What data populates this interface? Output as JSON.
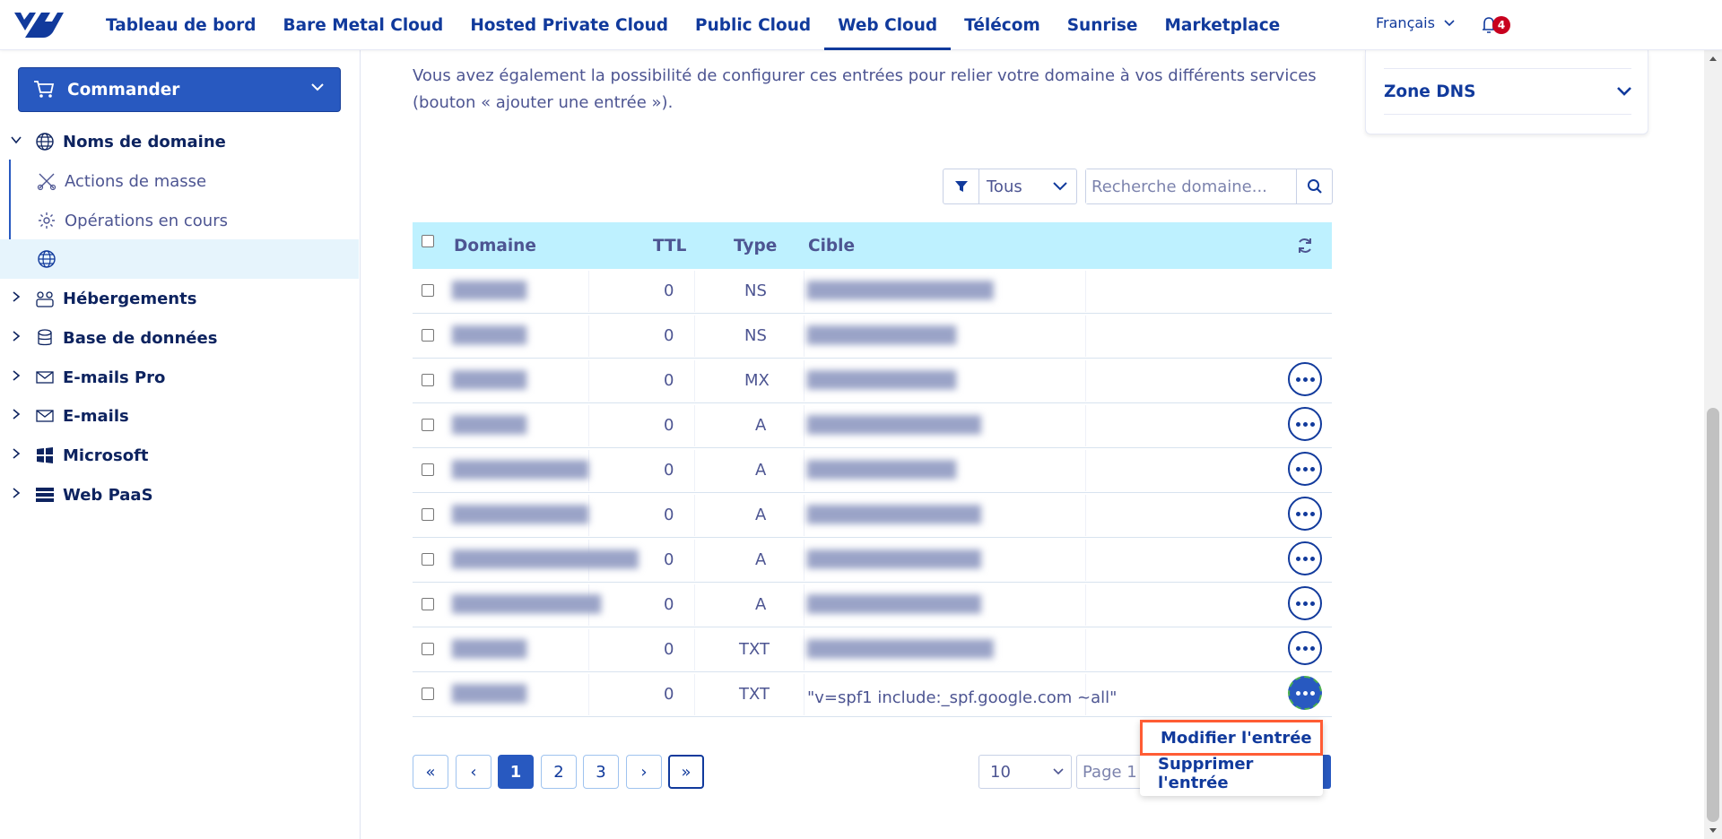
{
  "nav": {
    "items": [
      "Tableau de bord",
      "Bare Metal Cloud",
      "Hosted Private Cloud",
      "Public Cloud",
      "Web Cloud",
      "Télécom",
      "Sunrise",
      "Marketplace"
    ],
    "active": "Web Cloud",
    "language": "Français",
    "notifications_count": "4"
  },
  "sidebar": {
    "order_button": "Commander",
    "items": [
      {
        "label": "Noms de domaine",
        "icon": "globe-icon",
        "expanded": true
      },
      {
        "label": "Actions de masse",
        "icon": "scissors-icon"
      },
      {
        "label": "Opérations en cours",
        "icon": "gear-icon"
      },
      {
        "label": "",
        "icon": "globe-icon"
      },
      {
        "label": "Hébergements",
        "icon": "hosting-icon"
      },
      {
        "label": "Base de données",
        "icon": "database-icon"
      },
      {
        "label": "E-mails Pro",
        "icon": "mail-icon"
      },
      {
        "label": "E-mails",
        "icon": "mail-icon"
      },
      {
        "label": "Microsoft",
        "icon": "windows-icon"
      },
      {
        "label": "Web PaaS",
        "icon": "menu-icon"
      }
    ]
  },
  "intro_text": "Vous avez également la possibilité de configurer ces entrées pour relier votre domaine à vos différents services (bouton « ajouter une entrée »).",
  "filter": {
    "selected": "Tous"
  },
  "search": {
    "placeholder": "Recherche domaine...",
    "value": ""
  },
  "table": {
    "headers": {
      "domain": "Domaine",
      "ttl": "TTL",
      "type": "Type",
      "target": "Cible"
    },
    "rows": [
      {
        "domain": "██████",
        "ttl": "0",
        "type": "NS",
        "target": "███████████████",
        "actions": false
      },
      {
        "domain": "██████",
        "ttl": "0",
        "type": "NS",
        "target": "████████████",
        "actions": false
      },
      {
        "domain": "██████",
        "ttl": "0",
        "type": "MX",
        "target": "████████████",
        "actions": true
      },
      {
        "domain": "██████",
        "ttl": "0",
        "type": "A",
        "target": "██████████████",
        "actions": true
      },
      {
        "domain": "███████████",
        "ttl": "0",
        "type": "A",
        "target": "████████████",
        "actions": true
      },
      {
        "domain": "███████████",
        "ttl": "0",
        "type": "A",
        "target": "██████████████",
        "actions": true
      },
      {
        "domain": "███████████████",
        "ttl": "0",
        "type": "A",
        "target": "██████████████",
        "actions": true
      },
      {
        "domain": "████████████",
        "ttl": "0",
        "type": "A",
        "target": "██████████████",
        "actions": true
      },
      {
        "domain": "██████",
        "ttl": "0",
        "type": "TXT",
        "target": "███████████████",
        "actions": true
      },
      {
        "domain": "██████",
        "ttl": "0",
        "type": "TXT",
        "target": "\"v=spf1 include:_spf.google.com ~all\"",
        "actions": true,
        "active": true
      }
    ]
  },
  "context_menu": {
    "edit": "Modifier l'entrée",
    "delete": "Supprimer l'entrée"
  },
  "pagination": {
    "first": "«",
    "prev": "‹",
    "pages": [
      "1",
      "2",
      "3"
    ],
    "current": "1",
    "next": "›",
    "last": "»",
    "page_size": "10",
    "page_label": "Page 1 /"
  },
  "right_panel": {
    "zone_dns": "Zone DNS"
  },
  "colors": {
    "accent": "#2859c0",
    "header_bg": "#bef1ff",
    "nav_text": "#113a9c",
    "highlight": "#ff5c34",
    "badge": "#c8001e"
  }
}
